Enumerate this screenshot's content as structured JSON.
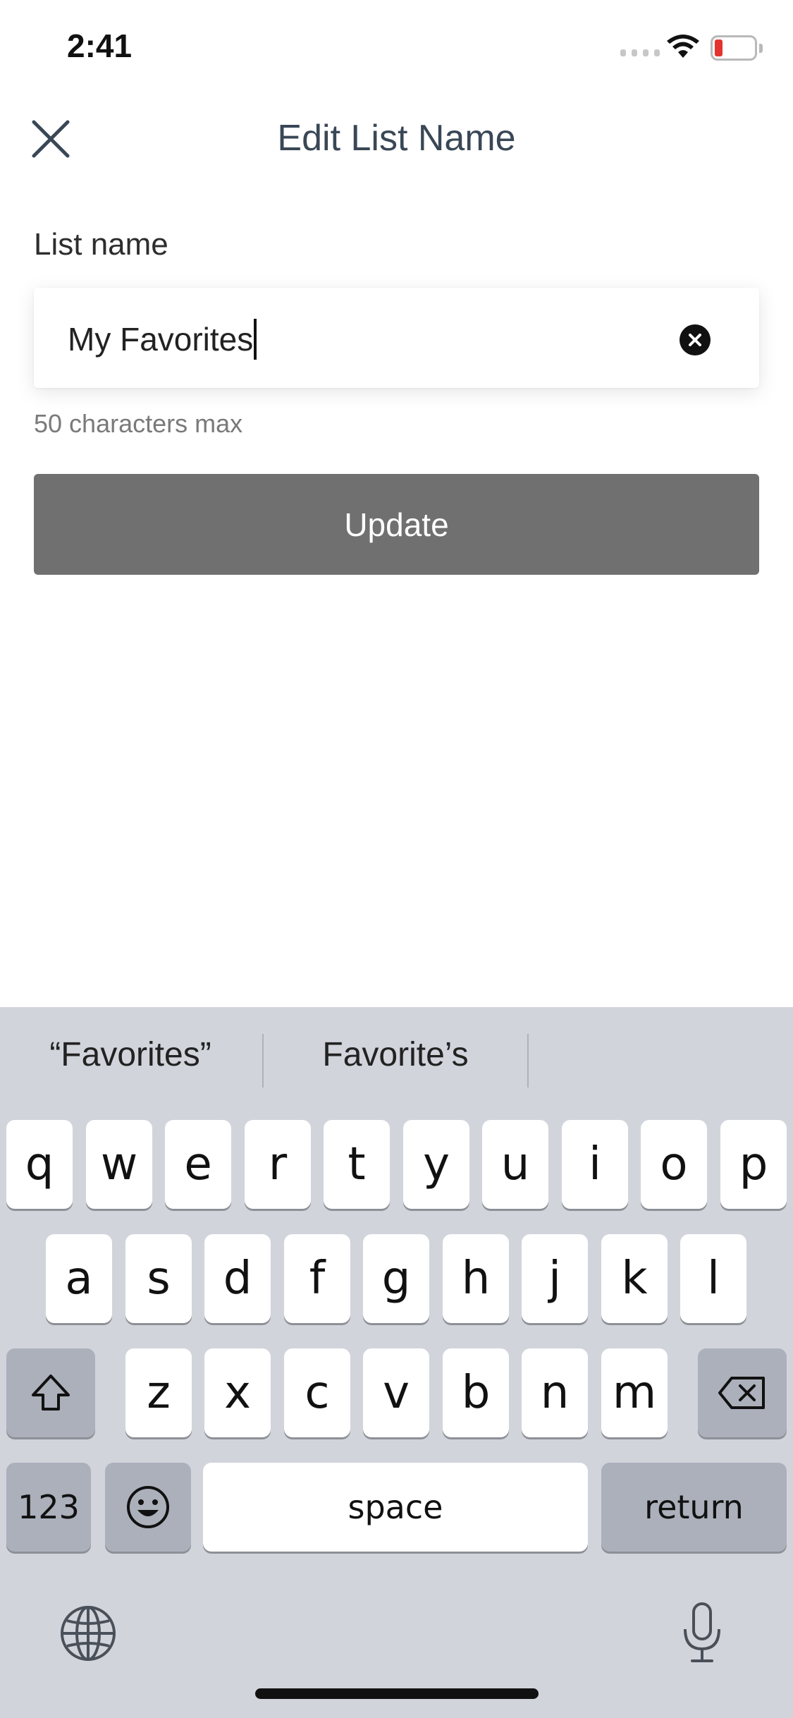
{
  "status_bar": {
    "time": "2:41",
    "battery_level": "11",
    "battery_color": "#e3342f"
  },
  "header": {
    "title": "Edit List Name",
    "close_icon": "close-icon"
  },
  "form": {
    "label": "List name",
    "value": "My Favorites",
    "helper": "50 characters max",
    "clear_icon": "clear-circle-icon"
  },
  "actions": {
    "update_label": "Update",
    "update_color": "#707070"
  },
  "keyboard": {
    "suggestions": [
      "“Favorites”",
      "Favorite’s",
      ""
    ],
    "row1": [
      "q",
      "w",
      "e",
      "r",
      "t",
      "y",
      "u",
      "i",
      "o",
      "p"
    ],
    "row2": [
      "a",
      "s",
      "d",
      "f",
      "g",
      "h",
      "j",
      "k",
      "l"
    ],
    "row3": [
      "z",
      "x",
      "c",
      "v",
      "b",
      "n",
      "m"
    ],
    "numbers_label": "123",
    "space_label": "space",
    "return_label": "return",
    "icons": {
      "shift": "shift-icon",
      "delete": "backspace-icon",
      "emoji": "emoji-icon",
      "globe": "globe-icon",
      "mic": "microphone-icon"
    }
  }
}
